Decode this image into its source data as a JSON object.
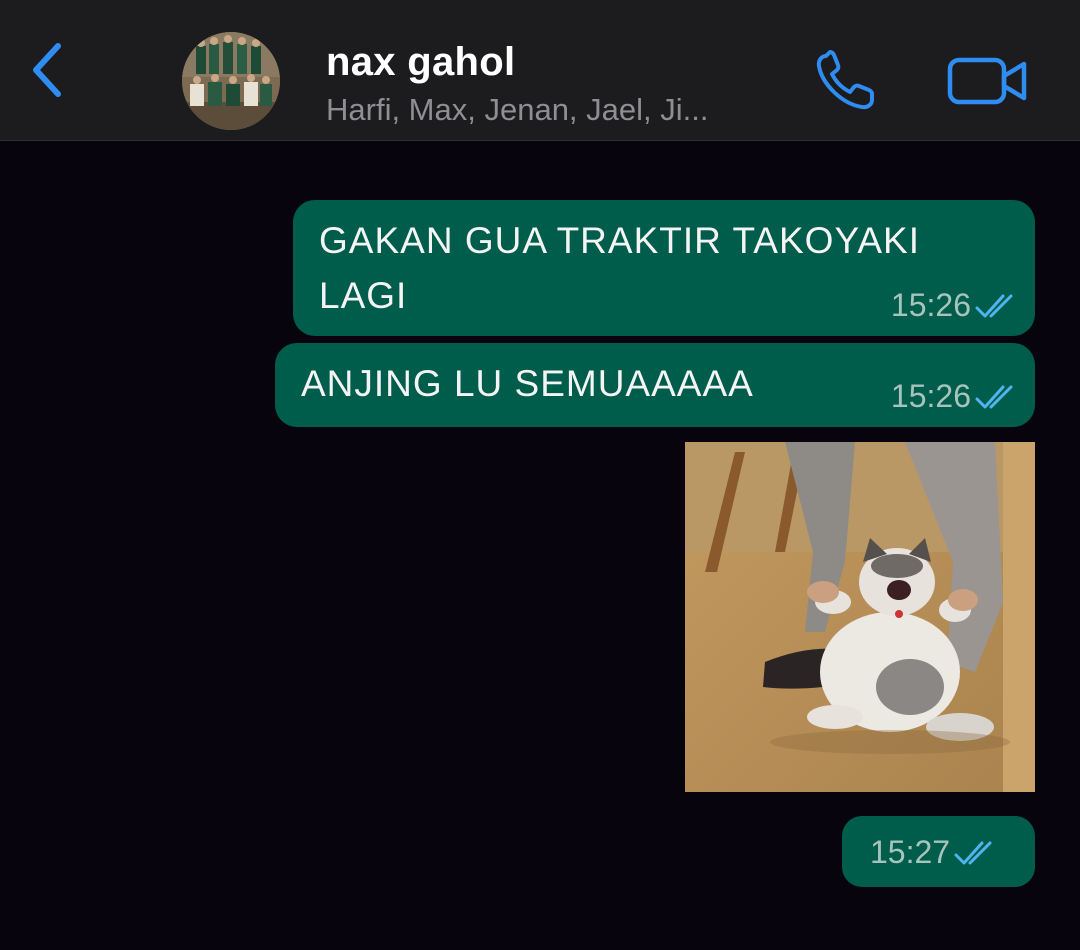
{
  "header": {
    "back_icon": "chevron-left-icon",
    "title": "nax gahol",
    "subtitle": "Harfi, Max, Jenan, Jael, Ji...",
    "call_icon": "phone-icon",
    "video_icon": "video-camera-icon",
    "accent_color": "#2f8cf0"
  },
  "messages": [
    {
      "type": "text",
      "lines": [
        "GAKAN GUA TRAKTIR TAKOYAKI",
        "LAGI"
      ],
      "time": "15:26",
      "status": "read"
    },
    {
      "type": "text",
      "lines": [
        "ANJING LU SEMUAAAAA"
      ],
      "time": "15:26",
      "status": "read"
    },
    {
      "type": "image",
      "description_icon": "cat-photo"
    },
    {
      "type": "timestamp-only",
      "time": "15:27",
      "status": "read"
    }
  ],
  "colors": {
    "background": "#07040d",
    "header": "#1c1c1e",
    "outgoing_bubble": "#005c4b",
    "read_tick": "#4fb4f0"
  }
}
